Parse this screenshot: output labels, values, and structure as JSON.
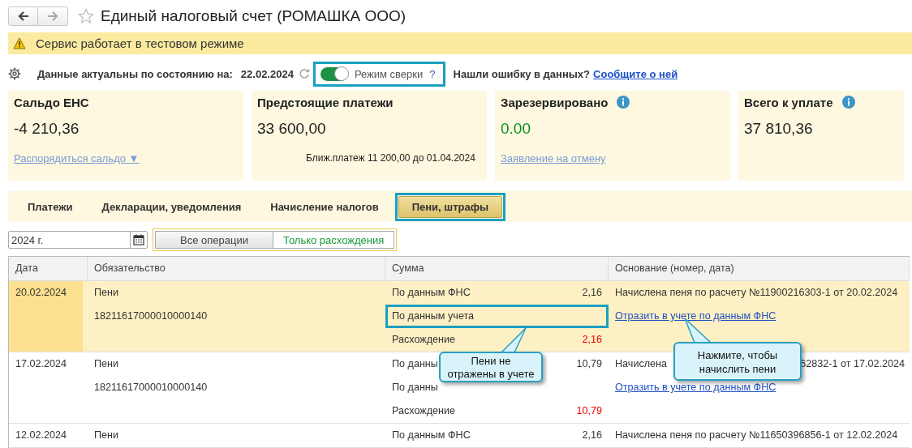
{
  "window": {
    "title": "Единый налоговый счет (РОМАШКА ООО)"
  },
  "banner": {
    "text": "Сервис работает в тестовом режиме"
  },
  "status": {
    "label": "Данные актуальны по состоянию на:",
    "date": "22.02.2024",
    "toggle": {
      "label": "Режим сверки",
      "on": true,
      "help": "?",
      "highlighted": true
    },
    "question": "Нашли ошибку в данных?",
    "link": "Сообщите о ней"
  },
  "cards": [
    {
      "title": "Сальдо ЕНС",
      "info": false,
      "value": "-4 210,36",
      "color": "#222222",
      "link": "Распорядиться сальдо ▼"
    },
    {
      "title": "Предстоящие платежи",
      "info": false,
      "value": "33 600,00",
      "color": "#222222",
      "note": "Ближ.платеж 11 200,00 до 01.04.2024"
    },
    {
      "title": "Зарезервировано",
      "info": true,
      "value": "0.00",
      "color": "#0a9020",
      "link": "Заявление на отмену"
    },
    {
      "title": "Всего к уплате",
      "info": true,
      "value": "37 810,36",
      "color": "#222222"
    }
  ],
  "tabs": [
    {
      "label": "Платежи",
      "selected": false,
      "highlighted": false
    },
    {
      "label": "Декларации, уведомления",
      "selected": false,
      "highlighted": false
    },
    {
      "label": "Начисление налогов",
      "selected": false,
      "highlighted": false
    },
    {
      "label": "Пени, штрафы",
      "selected": true,
      "highlighted": true
    }
  ],
  "filter": {
    "period": "2024 г.",
    "modes": [
      {
        "label": "Все операции",
        "selected": false
      },
      {
        "label": "Только расхождения",
        "selected": true
      }
    ]
  },
  "table": {
    "columns": [
      "Дата",
      "Обязательство",
      "Сумма",
      "Основание (номер, дата)"
    ],
    "rows": [
      {
        "date": "20.02.2024",
        "selected": true,
        "obligation": "Пени",
        "code": "18211617000010000140",
        "amounts": [
          {
            "label": "По данным ФНС",
            "value": "2,16",
            "kind": "normal",
            "highlighted": false
          },
          {
            "label": "По данным учета",
            "highlighted": true
          },
          {
            "label": "Расхождение",
            "value": "2,16",
            "kind": "discrepancy",
            "highlighted": false
          }
        ],
        "basis": [
          {
            "kind": "text",
            "text": "Начислена пеня по расчету №11900216303-1 от 20.02.2024"
          },
          {
            "kind": "link",
            "text": "Отразить в учете по данным ФНС"
          }
        ]
      },
      {
        "date": "17.02.2024",
        "selected": false,
        "obligation": "Пени",
        "code": "18211617000010000140",
        "amounts": [
          {
            "label": "По данны",
            "value": "10,79",
            "kind": "normal",
            "highlighted": false
          },
          {
            "label": "По данны",
            "highlighted": false
          },
          {
            "label": "Расхождение",
            "value": "10,79",
            "kind": "discrepancy",
            "highlighted": false
          }
        ],
        "basis": [
          {
            "kind": "split",
            "parts": [
              "Начислена",
              "62832-1 от 17.02.2024"
            ]
          },
          {
            "kind": "link",
            "text": "Отразить в учете по данным ФНС"
          }
        ]
      },
      {
        "date": "12.02.2024",
        "selected": false,
        "obligation": "Пени",
        "amounts": [
          {
            "label": "По данным ФНС",
            "value": "2,16",
            "kind": "normal",
            "highlighted": false
          }
        ],
        "basis": [
          {
            "kind": "text",
            "text": "Начислена пеня по расчету №11650396856-1 от 12.02.2024"
          }
        ]
      }
    ]
  },
  "callouts": [
    {
      "text": "Пени не отражены в учете"
    },
    {
      "text": "Нажмите, чтобы начислить пени"
    }
  ]
}
